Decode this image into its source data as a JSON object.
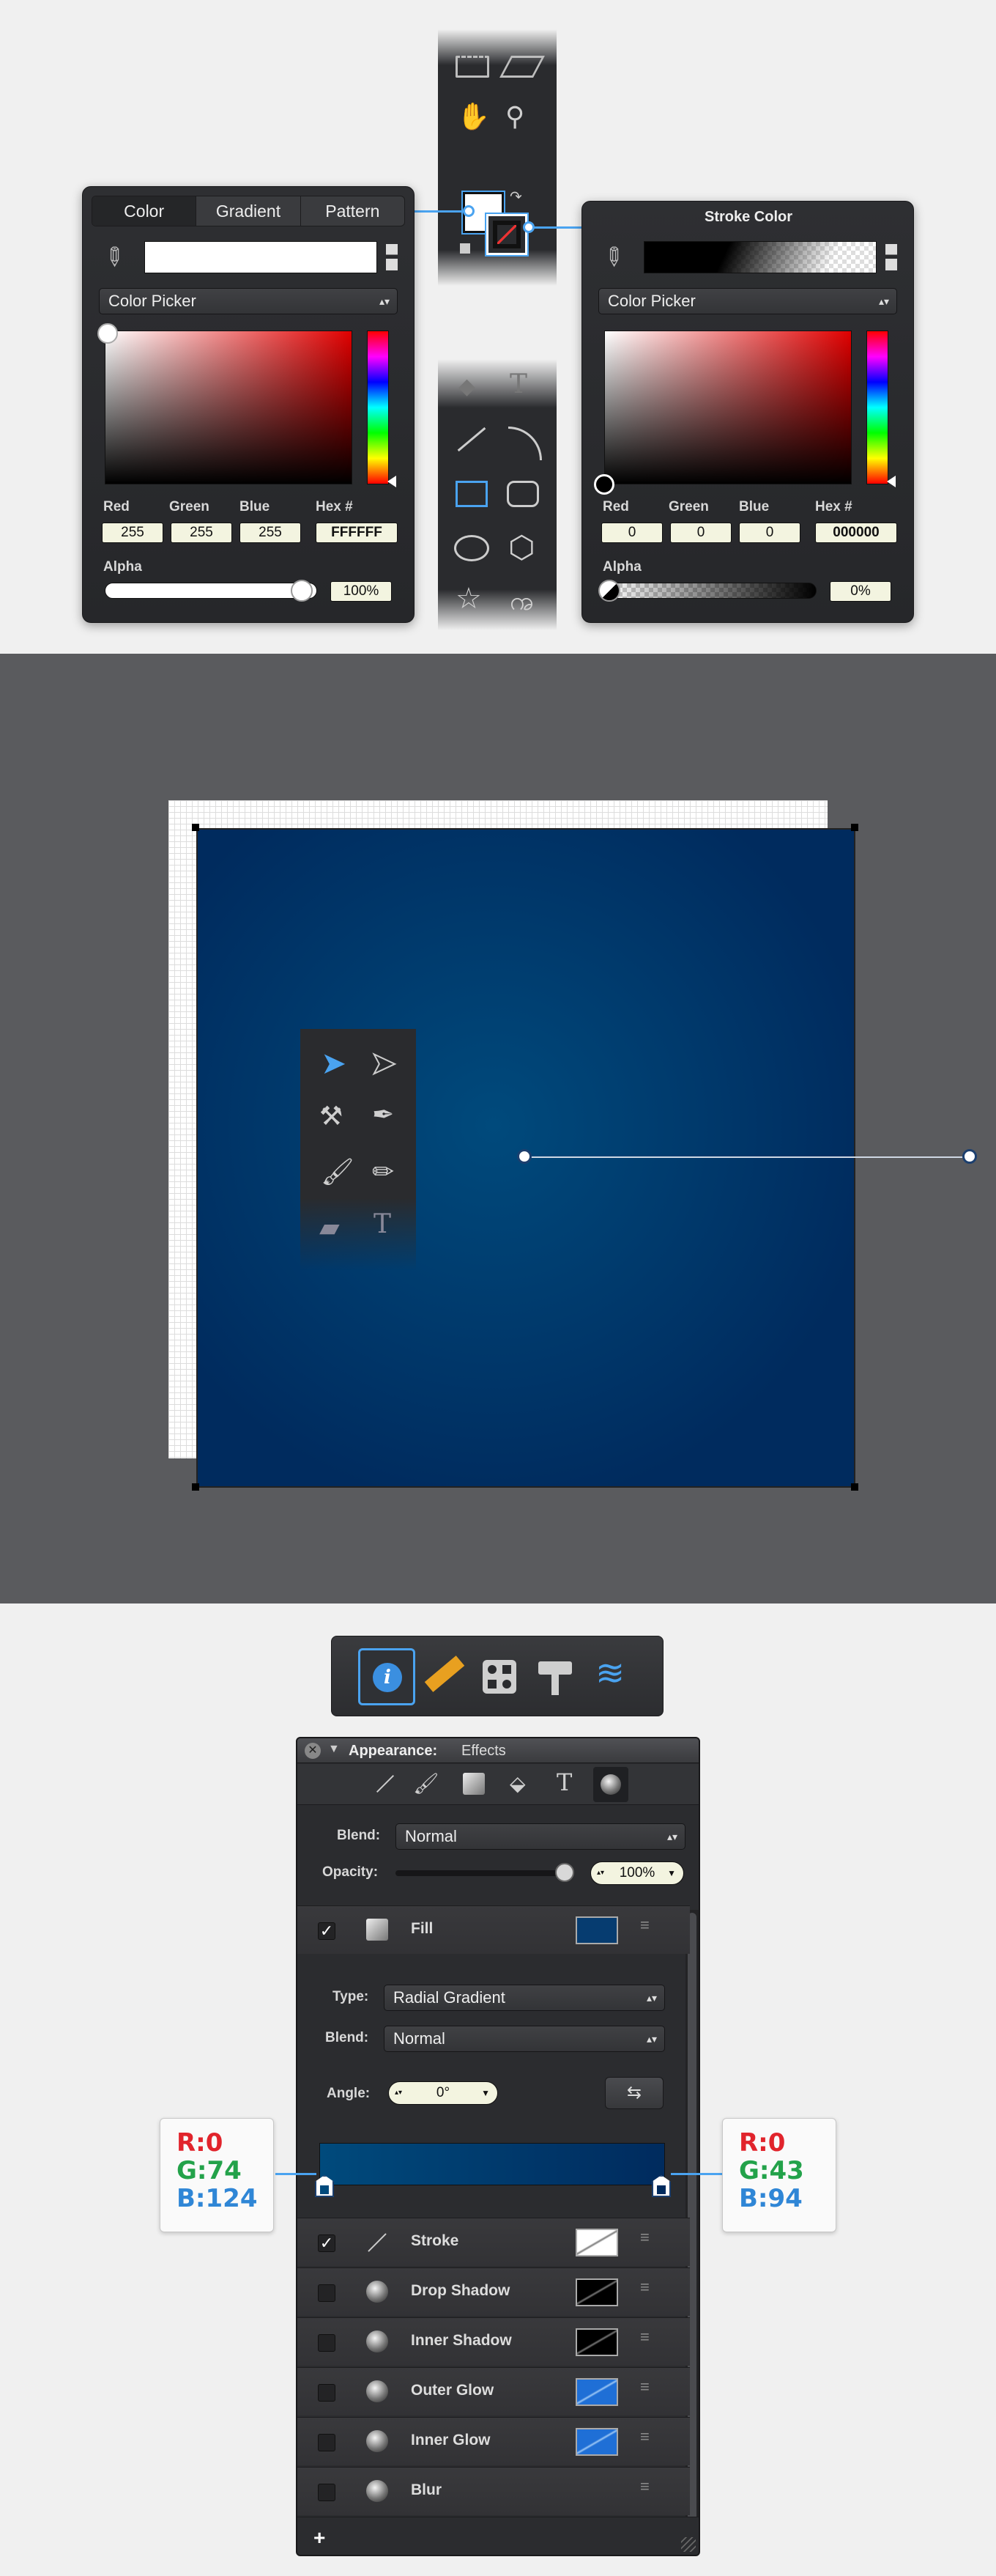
{
  "colors": {
    "accent": "#4aa3f0",
    "canvas_bg": "#5a5b5e",
    "gradient_inner": "#004a7c",
    "gradient_outer": "#002b5e"
  },
  "fill_panel": {
    "tabs": [
      "Color",
      "Gradient",
      "Pattern"
    ],
    "picker_label": "Color Picker",
    "field_labels": [
      "Red",
      "Green",
      "Blue",
      "Hex #"
    ],
    "values": {
      "red": "255",
      "green": "255",
      "blue": "255",
      "hex": "FFFFFF"
    },
    "alpha_label": "Alpha",
    "alpha_value": "100%"
  },
  "stroke_panel": {
    "title": "Stroke Color",
    "picker_label": "Color Picker",
    "field_labels": [
      "Red",
      "Green",
      "Blue",
      "Hex #"
    ],
    "values": {
      "red": "0",
      "green": "0",
      "blue": "0",
      "hex": "000000"
    },
    "alpha_label": "Alpha",
    "alpha_value": "0%"
  },
  "tools": {
    "top_strip": [
      "crop-icon",
      "skew-icon",
      "hand-icon",
      "zoom-icon",
      "fill-stroke-icon"
    ],
    "shape_strip": [
      "3d-icon",
      "text-icon",
      "line-icon",
      "arc-icon",
      "rectangle-icon",
      "rounded-rectangle-icon",
      "ellipse-icon",
      "polygon-icon",
      "star-icon",
      "spiral-icon"
    ],
    "canvas_palette": [
      "select-icon",
      "direct-select-icon",
      "knife-icon",
      "pen-icon",
      "brush-icon",
      "pencil-icon",
      "eraser-icon",
      "text-icon"
    ],
    "inspector_tabs": [
      "info-icon",
      "ruler-icon",
      "shapes-icon",
      "style-brush-icon",
      "layers-icon"
    ]
  },
  "appearance": {
    "header_label": "Appearance:",
    "header_value": "Effects",
    "blend_label": "Blend:",
    "blend_value": "Normal",
    "opacity_label": "Opacity:",
    "opacity_value": "100%",
    "opacity_level": 1.0,
    "fill": {
      "label": "Fill",
      "checked": true
    },
    "fill_settings": {
      "type_label": "Type:",
      "type_value": "Radial Gradient",
      "blend_label": "Blend:",
      "blend_value": "Normal",
      "angle_label": "Angle:",
      "angle_value": "0°"
    },
    "effects": [
      {
        "label": "Stroke",
        "checked": true
      },
      {
        "label": "Drop Shadow",
        "checked": false
      },
      {
        "label": "Inner Shadow",
        "checked": false
      },
      {
        "label": "Outer Glow",
        "checked": false
      },
      {
        "label": "Inner Glow",
        "checked": false
      },
      {
        "label": "Blur",
        "checked": false
      }
    ],
    "add_label": "+"
  },
  "gradient_stops": {
    "left": {
      "r": "R:0",
      "g": "G:74",
      "b": "B:124"
    },
    "right": {
      "r": "R:0",
      "g": "G:43",
      "b": "B:94"
    }
  }
}
